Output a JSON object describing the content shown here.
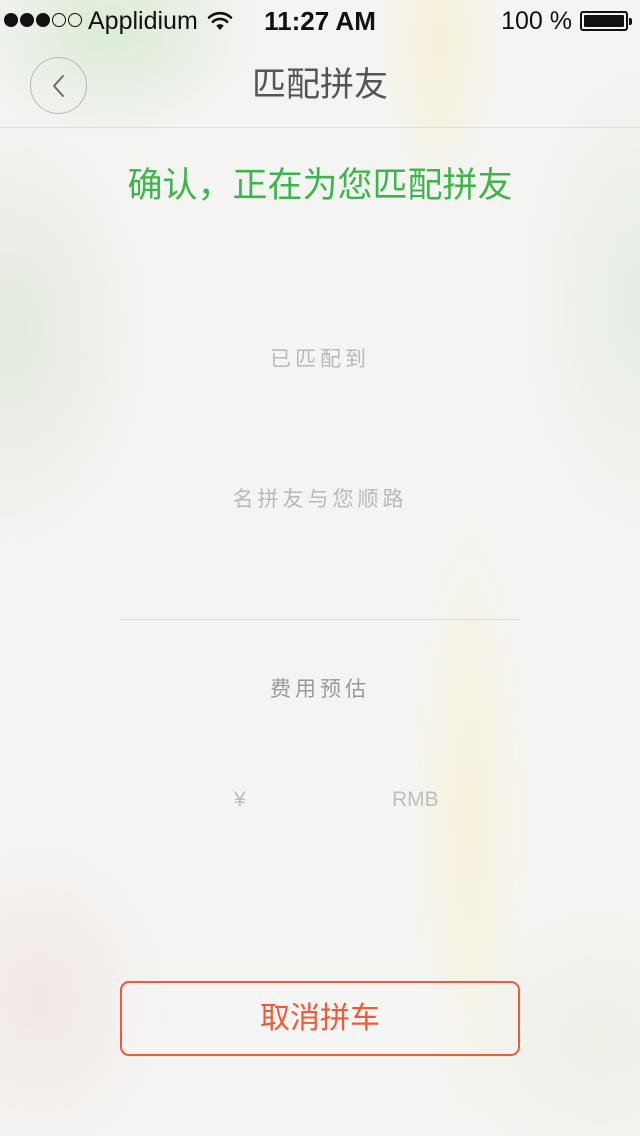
{
  "status_bar": {
    "signal": {
      "filled": 3,
      "total": 5
    },
    "carrier": "Applidium",
    "wifi_icon": "wifi-icon",
    "time": "11:27 AM",
    "battery_text": "100 %",
    "battery_level": 1.0,
    "battery_icon": "battery-icon"
  },
  "nav": {
    "back_icon": "chevron-left-icon",
    "title": "匹配拼友"
  },
  "main": {
    "status_heading": "确认，正在为您匹配拼友",
    "matched_label": "已匹配到",
    "matched_desc": "名拼友与您顺路",
    "fare_label": "费用预估",
    "currency_symbol": "¥",
    "currency_unit": "RMB"
  },
  "actions": {
    "cancel_label": "取消拼车"
  },
  "colors": {
    "accent_green": "#3db54a",
    "cancel_red": "#f05a3a"
  }
}
